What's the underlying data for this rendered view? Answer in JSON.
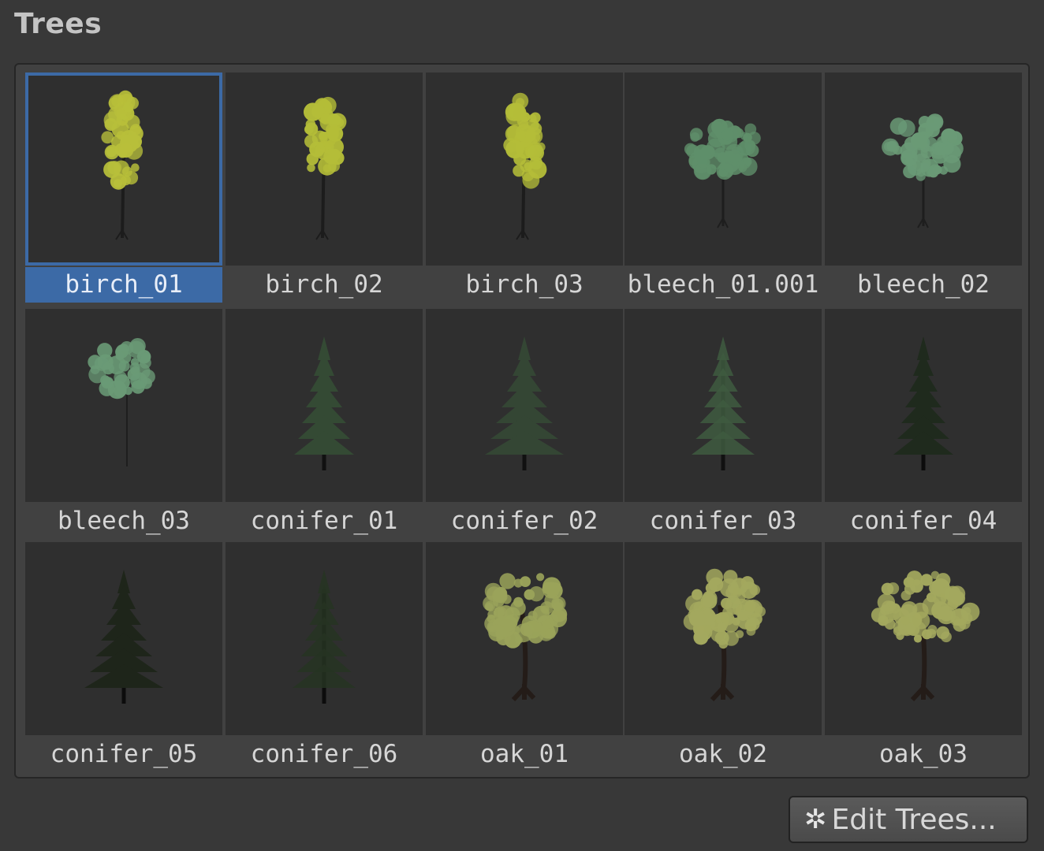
{
  "section": {
    "title": "Trees"
  },
  "trees": [
    {
      "name": "birch_01",
      "kind": "birch",
      "foliage": "#b8bf3a",
      "trunk": "#1c1c1c",
      "selected": true
    },
    {
      "name": "birch_02",
      "kind": "birch",
      "foliage": "#b4bd38",
      "trunk": "#1c1c1c",
      "selected": false
    },
    {
      "name": "birch_03",
      "kind": "birch",
      "foliage": "#b4bd38",
      "trunk": "#1c1c1c",
      "selected": false
    },
    {
      "name": "bleech_01.001",
      "kind": "round",
      "foliage": "#5f8f6a",
      "trunk": "#1e1e1e",
      "selected": false
    },
    {
      "name": "bleech_02",
      "kind": "round",
      "foliage": "#6a9a76",
      "trunk": "#1e1e1e",
      "selected": false
    },
    {
      "name": "bleech_03",
      "kind": "small-round",
      "foliage": "#6a9a76",
      "trunk": "#1e1e1e",
      "selected": false
    },
    {
      "name": "conifer_01",
      "kind": "conifer",
      "foliage": "#344a34",
      "trunk": "#111111",
      "selected": false
    },
    {
      "name": "conifer_02",
      "kind": "wide-conifer",
      "foliage": "#344634",
      "trunk": "#111111",
      "selected": false
    },
    {
      "name": "conifer_03",
      "kind": "sparse-conifer",
      "foliage": "#3e5a40",
      "trunk": "#111111",
      "selected": false
    },
    {
      "name": "conifer_04",
      "kind": "conifer",
      "foliage": "#1f2a1d",
      "trunk": "#0c0c0c",
      "selected": false
    },
    {
      "name": "conifer_05",
      "kind": "wide-conifer",
      "foliage": "#1e251a",
      "trunk": "#0c0c0c",
      "selected": false
    },
    {
      "name": "conifer_06",
      "kind": "sparse-conifer",
      "foliage": "#263422",
      "trunk": "#0c0c0c",
      "selected": false
    },
    {
      "name": "oak_01",
      "kind": "oak",
      "foliage": "#9aa35a",
      "trunk": "#241c18",
      "selected": false
    },
    {
      "name": "oak_02",
      "kind": "oak",
      "foliage": "#a3a85e",
      "trunk": "#241c18",
      "selected": false
    },
    {
      "name": "oak_03",
      "kind": "oak-wide",
      "foliage": "#a3a85e",
      "trunk": "#241c18",
      "selected": false
    }
  ],
  "footer": {
    "edit_label": "Edit Trees...",
    "icon": "gear-icon"
  }
}
